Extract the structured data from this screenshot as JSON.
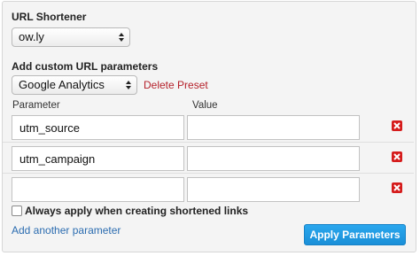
{
  "shortener": {
    "title": "URL Shortener",
    "selected": "ow.ly"
  },
  "params": {
    "title": "Add custom URL parameters",
    "preset_selected": "Google Analytics",
    "delete_preset": "Delete Preset",
    "col_parameter": "Parameter",
    "col_value": "Value",
    "rows": [
      {
        "parameter": "utm_source",
        "value": ""
      },
      {
        "parameter": "utm_campaign",
        "value": ""
      },
      {
        "parameter": "",
        "value": ""
      }
    ]
  },
  "always_apply": {
    "label": "Always apply when creating shortened links",
    "checked": false
  },
  "add_another": "Add another parameter",
  "apply_button": "Apply Parameters",
  "colors": {
    "delete_red": "#d51c1c",
    "link_blue": "#2b6cb0",
    "button_blue": "#1a8fd8"
  }
}
